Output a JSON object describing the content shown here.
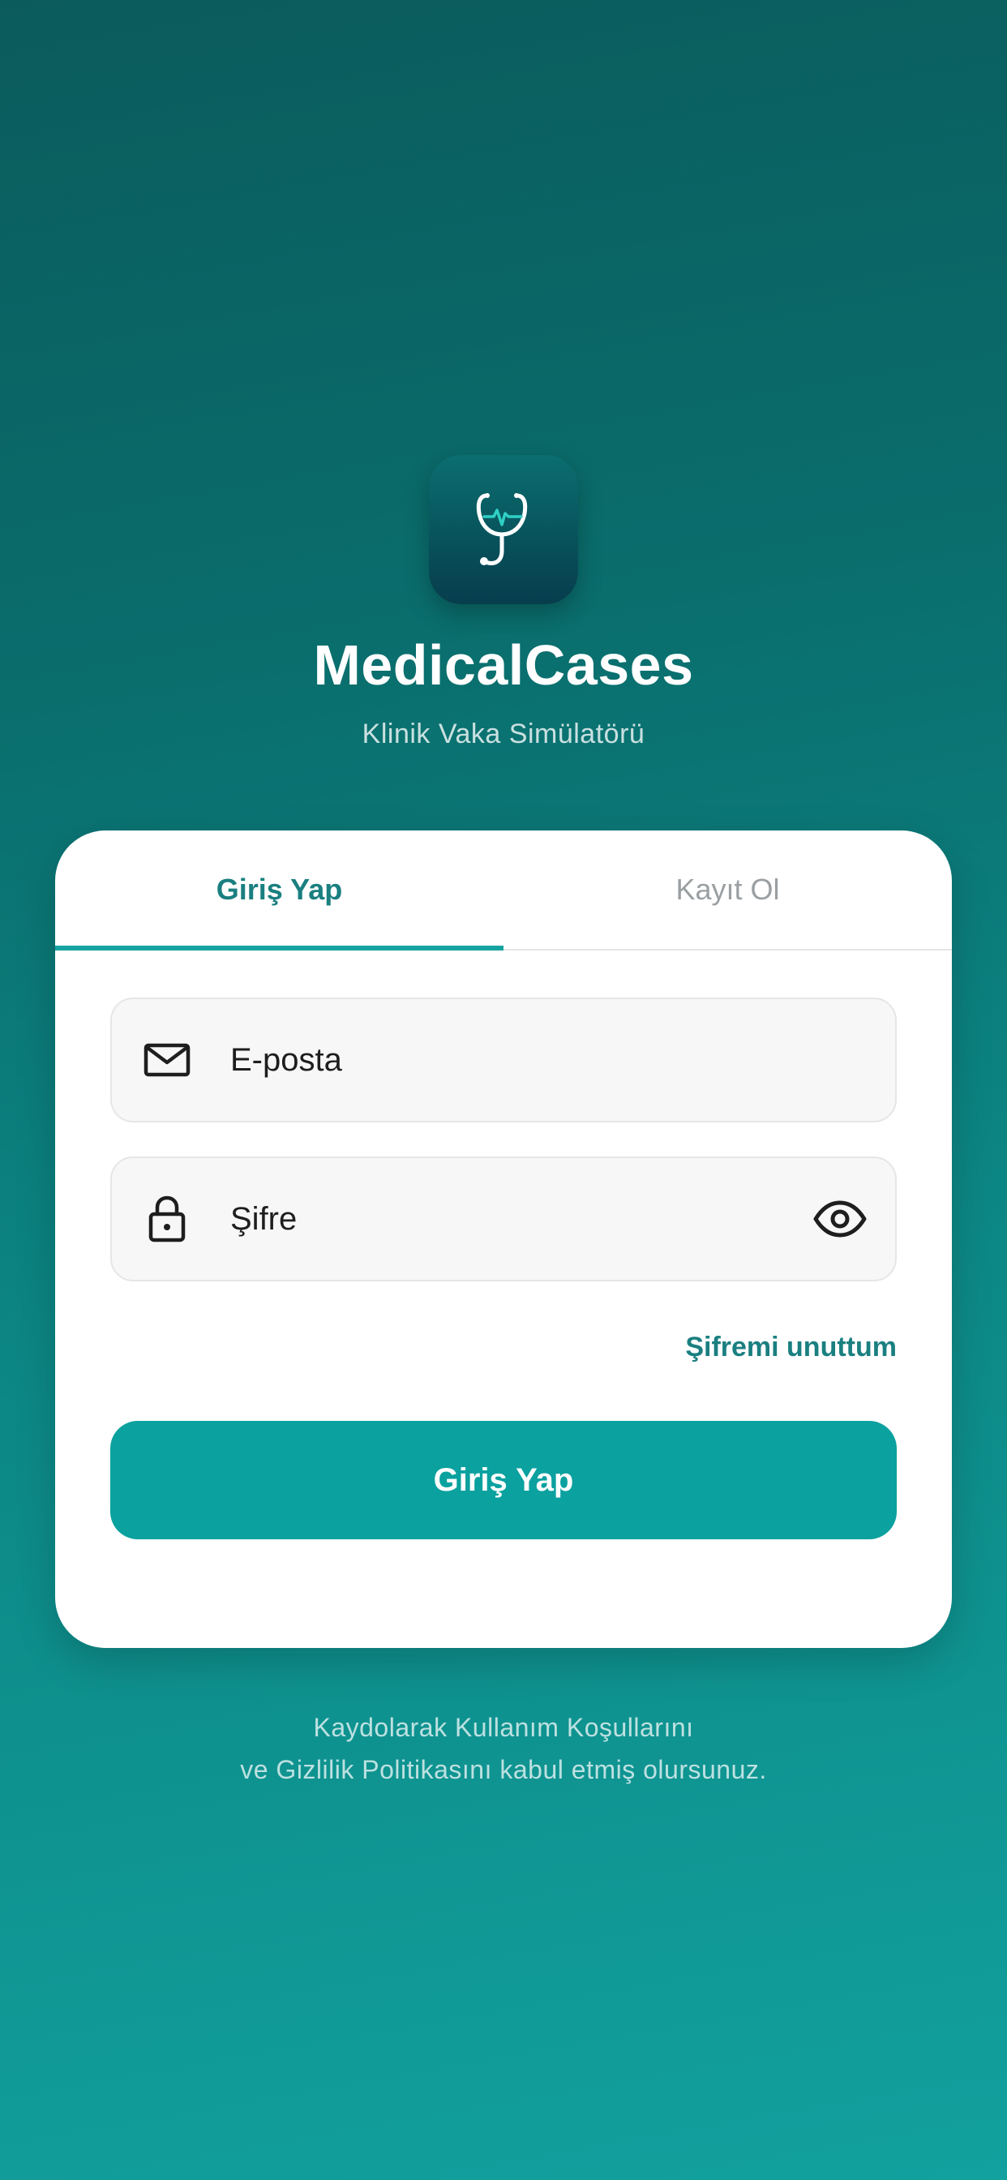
{
  "app": {
    "title": "MedicalCases",
    "subtitle": "Klinik Vaka Simülatörü",
    "icon": "stethoscope-icon"
  },
  "tabs": [
    {
      "label": "Giriş Yap",
      "active": true
    },
    {
      "label": "Kayıt Ol",
      "active": false
    }
  ],
  "form": {
    "email": {
      "placeholder": "E-posta",
      "value": "",
      "icon": "mail-icon"
    },
    "password": {
      "placeholder": "Şifre",
      "value": "",
      "icon": "lock-icon",
      "toggle_icon": "eye-icon"
    },
    "forgot_label": "Şifremi unuttum",
    "submit_label": "Giriş Yap"
  },
  "terms": {
    "line1": "Kaydolarak Kullanım Koşullarını",
    "line2": "ve Gizlilik Politikasını kabul etmiş olursunuz."
  },
  "colors": {
    "accent": "#0aa19f",
    "accent_text": "#1a7f80",
    "background_top": "#0b5b5c",
    "background_bottom": "#12a19e"
  }
}
